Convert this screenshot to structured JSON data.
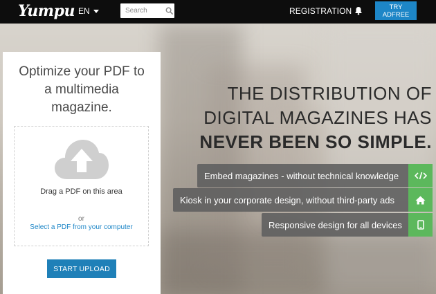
{
  "nav": {
    "logo": "Yumpu",
    "language": "EN",
    "search_placeholder": "Search",
    "registration": "REGISTRATION",
    "try_line1": "TRY",
    "try_line2": "ADFREE"
  },
  "card": {
    "title_line1": "Optimize your PDF to",
    "title_line2": "a multimedia",
    "title_line3": "magazine.",
    "drag_text": "Drag a PDF on this area",
    "or_text": "or",
    "select_link": "Select a PDF from your computer",
    "start_button": "START UPLOAD"
  },
  "headline": {
    "line1": "THE DISTRIBUTION OF",
    "line2": "DIGITAL MAGAZINES HAS",
    "line3": "NEVER BEEN SO SIMPLE."
  },
  "features": [
    {
      "text": "Embed magazines - without technical knowledge",
      "icon": "code-icon"
    },
    {
      "text": "Kiosk in your corporate design, without third-party ads",
      "icon": "home-icon"
    },
    {
      "text": "Responsive design for all devices",
      "icon": "tablet-icon"
    }
  ],
  "colors": {
    "nav_bg": "#0d0d0d",
    "accent_blue": "#1d86c7",
    "feature_green": "#5cb85c",
    "feature_bar": "#5f5f5f"
  }
}
